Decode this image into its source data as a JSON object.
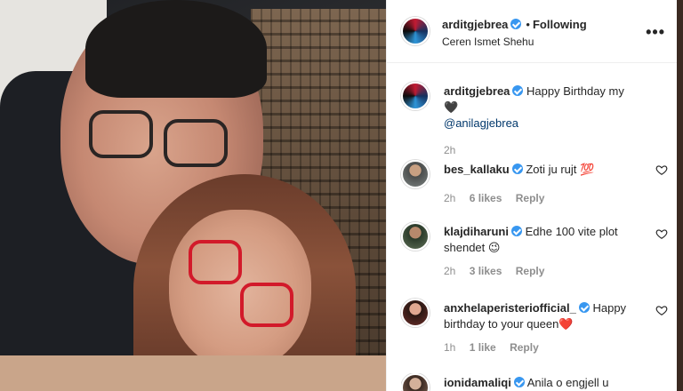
{
  "post": {
    "author": "arditgjebrea",
    "follow_status": "Following",
    "separator": "•",
    "location": "Ceren Ismet Shehu",
    "more_label": "•••"
  },
  "caption": {
    "username": "arditgjebrea",
    "text": "Happy Birthday my",
    "emoji": "🖤",
    "mention": "@anilagjebrea",
    "time": "2h"
  },
  "comments": [
    {
      "username": "bes_kallaku",
      "verified": true,
      "text": "Zoti ju rujt",
      "emoji": "💯",
      "time": "2h",
      "likes": "6 likes",
      "reply": "Reply"
    },
    {
      "username": "klajdiharuni",
      "verified": true,
      "text": "Edhe 100 vite plot shendet",
      "emoji": "😉",
      "time": "2h",
      "likes": "3 likes",
      "reply": "Reply"
    },
    {
      "username": "anxhelaperisteriofficial_",
      "verified": true,
      "text": "Happy birthday to your queen",
      "emoji": "❤️",
      "time": "1h",
      "likes": "1 like",
      "reply": "Reply"
    },
    {
      "username": "ionidamaliqi",
      "verified": true,
      "text": "Anila o engjell u",
      "emoji": "",
      "time": "",
      "likes": "",
      "reply": ""
    }
  ],
  "colors": {
    "verified": "#3897f0",
    "mention": "#00376b",
    "muted": "#8e8e8e",
    "glasses_red": "#d21a2a"
  }
}
